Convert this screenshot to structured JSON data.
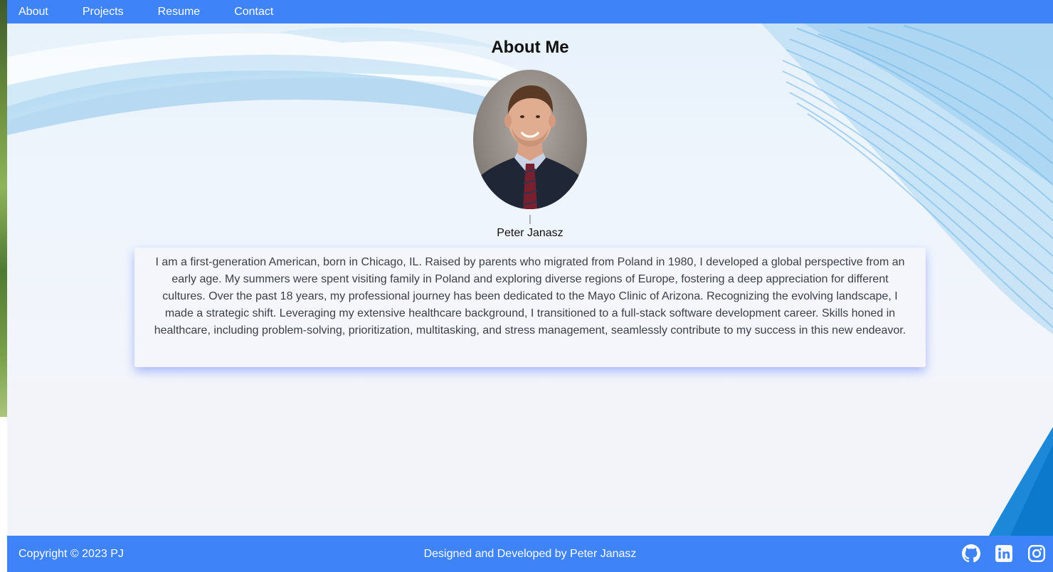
{
  "nav": {
    "items": [
      {
        "label": "About"
      },
      {
        "label": "Projects"
      },
      {
        "label": "Resume"
      },
      {
        "label": "Contact"
      }
    ]
  },
  "about": {
    "title": "About Me",
    "divider": "|",
    "name": "Peter Janasz",
    "bio": "I am a first-generation American, born in Chicago, IL. Raised by parents who migrated from Poland in 1980, I developed a global perspective from an early age. My summers were spent visiting family in Poland and exploring diverse regions of Europe, fostering a deep appreciation for different cultures. Over the past 18 years, my professional journey has been dedicated to the Mayo Clinic of Arizona. Recognizing the evolving landscape, I made a strategic shift. Leveraging my extensive healthcare background, I transitioned to a full-stack software development career. Skills honed in healthcare, including problem-solving, prioritization, multitasking, and stress management, seamlessly contribute to my success in this new endeavor."
  },
  "footer": {
    "copyright": "Copyright © 2023 PJ",
    "credit": "Designed and Developed by Peter Janasz",
    "socials": [
      {
        "icon": "github-icon"
      },
      {
        "icon": "linkedin-icon"
      },
      {
        "icon": "instagram-icon"
      }
    ]
  },
  "colors": {
    "accent": "#3f83f8",
    "text": "#3a3f47"
  }
}
